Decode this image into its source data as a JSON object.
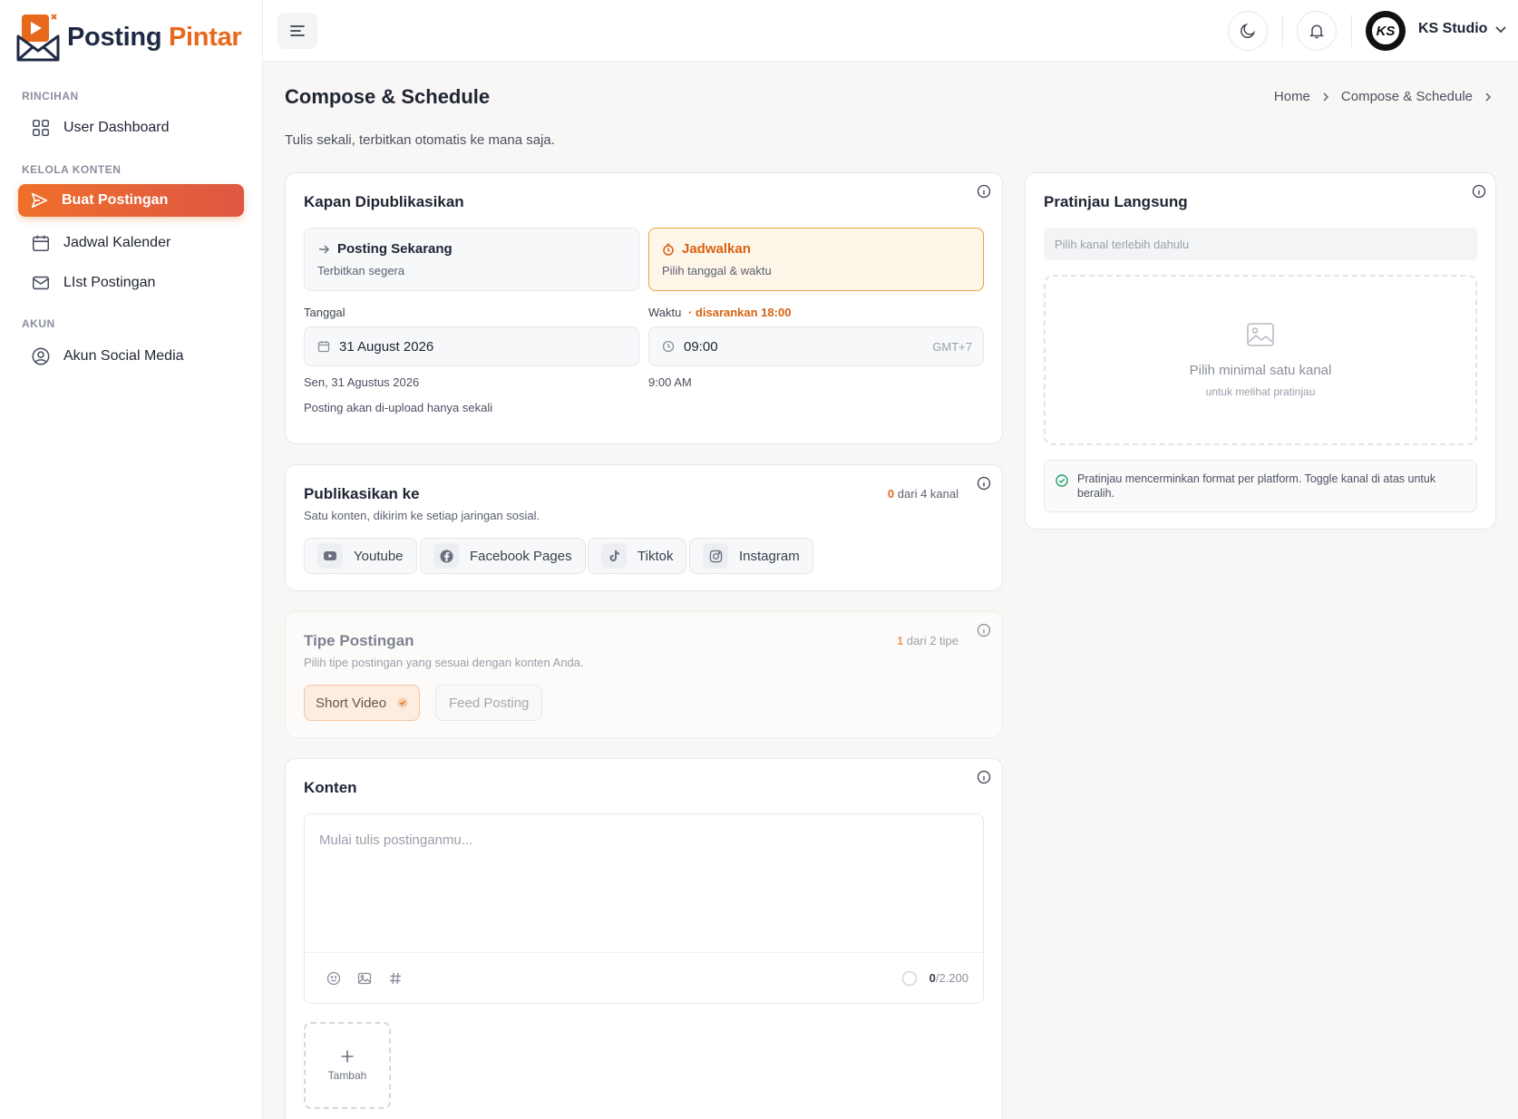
{
  "brand": {
    "name_main": "Posting",
    "name_accent": "Pintar",
    "accent_color": "#e8681c"
  },
  "sidebar": {
    "sections": [
      {
        "title": "RINCIHAN"
      },
      {
        "title": "KELOLA KONTEN"
      },
      {
        "title": "AKUN"
      }
    ],
    "items": [
      {
        "label": "User Dashboard",
        "icon": "dashboard-grid-icon"
      },
      {
        "label": "Buat Postingan",
        "icon": "send-icon",
        "active": true
      },
      {
        "label": "Jadwal Kalender",
        "icon": "calendar-icon"
      },
      {
        "label": "LIst Postingan",
        "icon": "mail-icon"
      },
      {
        "label": "Akun Social Media",
        "icon": "user-circle-icon"
      }
    ]
  },
  "topbar": {
    "user_name": "KS Studio",
    "avatar_initials": "KS"
  },
  "page": {
    "title": "Compose & Schedule",
    "subtitle": "Tulis sekali, terbitkan otomatis ke mana saja.",
    "breadcrumb": [
      "Home",
      "Compose & Schedule"
    ]
  },
  "schedule_card": {
    "title": "Kapan Dipublikasikan",
    "options": [
      {
        "title": "Posting Sekarang",
        "subtitle": "Terbitkan segera",
        "selected": false
      },
      {
        "title": "Jadwalkan",
        "subtitle": "Pilih tanggal & waktu",
        "selected": true
      }
    ],
    "date_label": "Tanggal",
    "date_value": "31 August 2026",
    "date_hint": "Sen, 31 Agustus 2026",
    "time_label": "Waktu",
    "time_suggestion": "· disarankan 18:00",
    "time_value": "09:00",
    "timezone": "GMT+7",
    "time_hint": "9:00 AM",
    "upload_note": "Posting akan di-upload hanya sekali"
  },
  "publish_card": {
    "title": "Publikasikan ke",
    "subtitle": "Satu konten, dikirim ke setiap jaringan sosial.",
    "count_selected": "0",
    "count_total_text": "dari 4 kanal",
    "channels": [
      {
        "label": "Youtube",
        "icon": "youtube-icon"
      },
      {
        "label": "Facebook Pages",
        "icon": "facebook-icon"
      },
      {
        "label": "Tiktok",
        "icon": "tiktok-icon"
      },
      {
        "label": "Instagram",
        "icon": "instagram-icon"
      }
    ]
  },
  "type_card": {
    "title": "Tipe Postingan",
    "subtitle": "Pilih tipe postingan yang sesuai dengan konten Anda.",
    "count_selected": "1",
    "count_total_text": "dari 2 tipe",
    "types": [
      {
        "label": "Short Video",
        "selected": true
      },
      {
        "label": "Feed Posting",
        "selected": false
      }
    ]
  },
  "content_card": {
    "title": "Konten",
    "placeholder": "Mulai tulis postinganmu...",
    "char_count": "0",
    "char_limit": "/2.200",
    "add_label": "Tambah"
  },
  "preview_card": {
    "title": "Pratinjau Langsung",
    "channel_placeholder": "Pilih kanal terlebih dahulu",
    "empty_title": "Pilih minimal satu kanal",
    "empty_subtitle": "untuk melihat pratinjau",
    "note": "Pratinjau mencerminkan format per platform. Toggle kanal di atas untuk beralih."
  }
}
